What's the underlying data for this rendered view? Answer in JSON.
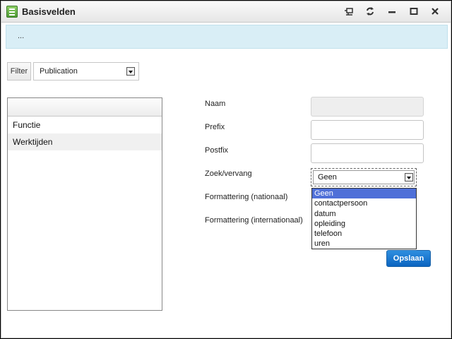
{
  "window": {
    "title": "Basisvelden",
    "controls": [
      "pin-icon",
      "refresh-icon",
      "minimize-icon",
      "maximize-icon",
      "close-icon"
    ]
  },
  "info_bar": {
    "text": "..."
  },
  "filter": {
    "button_label": "Filter",
    "select_value": "Publication"
  },
  "list": {
    "items": [
      {
        "label": "Functie"
      },
      {
        "label": "Werktijden"
      }
    ]
  },
  "form": {
    "labels": {
      "naam": "Naam",
      "prefix": "Prefix",
      "postfix": "Postfix",
      "zoek": "Zoek/vervang",
      "format_nat": "Formattering (nationaal)",
      "format_int": "Formattering (internationaal)"
    },
    "values": {
      "naam": "",
      "prefix": "",
      "postfix": ""
    },
    "zoek_value": "Geen",
    "zoek_options": [
      "Geen",
      "contactpersoon",
      "datum",
      "opleiding",
      "telefoon",
      "uren"
    ],
    "save_label": "Opslaan"
  },
  "colors": {
    "info_bar": "#d9eef6",
    "selected_option": "#4f70d8",
    "save_button": "#0b64c0"
  }
}
